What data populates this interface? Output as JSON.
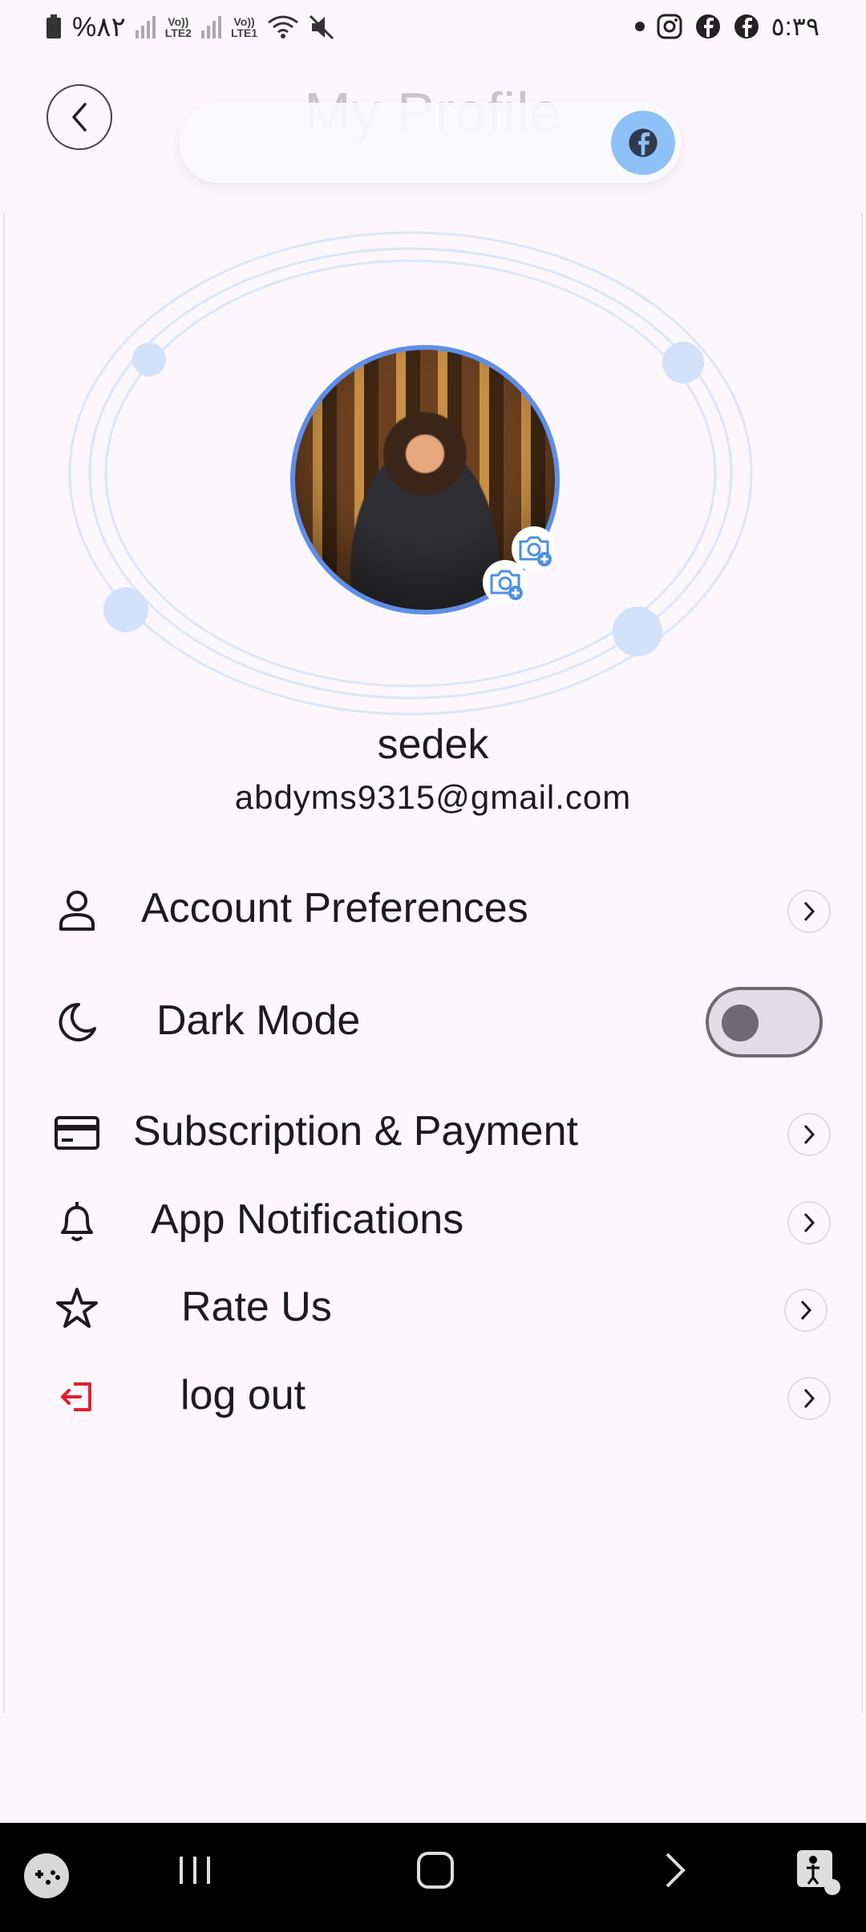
{
  "status_bar": {
    "battery": "%٨٢",
    "sim2": "LTE2",
    "sim1": "LTE1",
    "volte": "Vo))",
    "time": "٥:٣٩"
  },
  "header": {
    "title": "My Profile",
    "back_icon": "chevron-left-icon",
    "toast_icon": "facebook-icon"
  },
  "profile": {
    "name": "sedek",
    "email": "abdyms9315@gmail.com",
    "avatar_ring_color": "#5f8ee8"
  },
  "menu": {
    "items": [
      {
        "label": "Account Preferences",
        "icon": "user-icon"
      },
      {
        "label": "Dark Mode",
        "icon": "moon-icon",
        "toggle_on": false
      },
      {
        "label": "Subscription & Payment",
        "icon": "credit-card-icon"
      },
      {
        "label": "App Notifications",
        "icon": "bell-icon"
      },
      {
        "label": "Rate Us",
        "icon": "star-icon"
      },
      {
        "label": "log out",
        "icon": "logout-icon",
        "icon_color": "#e0202e"
      }
    ]
  },
  "navbar": {
    "items": [
      "game-launcher-icon",
      "recents-icon",
      "home-icon",
      "back-icon",
      "accessibility-icon"
    ]
  },
  "colors": {
    "background": "#fcf7fd",
    "accent": "#5f8ee8",
    "orbit": "#dbe6fb"
  }
}
